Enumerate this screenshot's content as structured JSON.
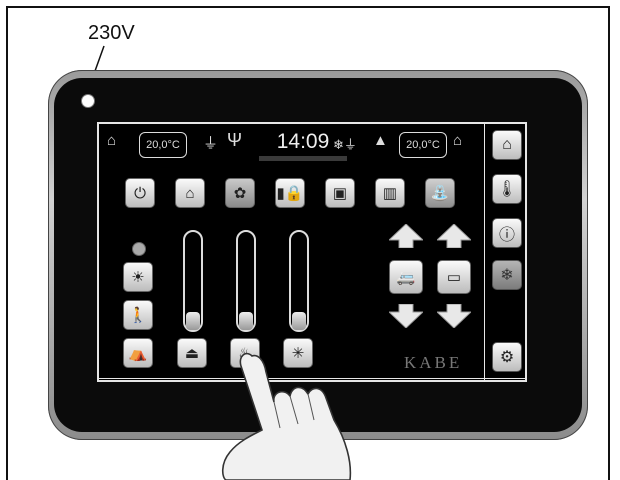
{
  "callout": {
    "label": "230V"
  },
  "status_bar": {
    "inside_temp": "20,0°C",
    "time": "14:09",
    "outside_temp": "20,0°C"
  },
  "icons": {
    "home": "house-icon",
    "power": "power-icon",
    "settings": "gear-icon",
    "info": "info-icon",
    "thermometer": "thermometer-icon",
    "snowflake": "snowflake-icon"
  },
  "top_buttons": [
    "power-button",
    "home-mode-button",
    "map-button",
    "battery-lock-button",
    "radio-button",
    "heater-button",
    "tap-button"
  ],
  "sliders": [
    {
      "name": "slider-1",
      "level": 0.08
    },
    {
      "name": "slider-2",
      "level": 0.08
    },
    {
      "name": "slider-3",
      "level": 0.08
    }
  ],
  "brand": {
    "text": "KABE"
  }
}
